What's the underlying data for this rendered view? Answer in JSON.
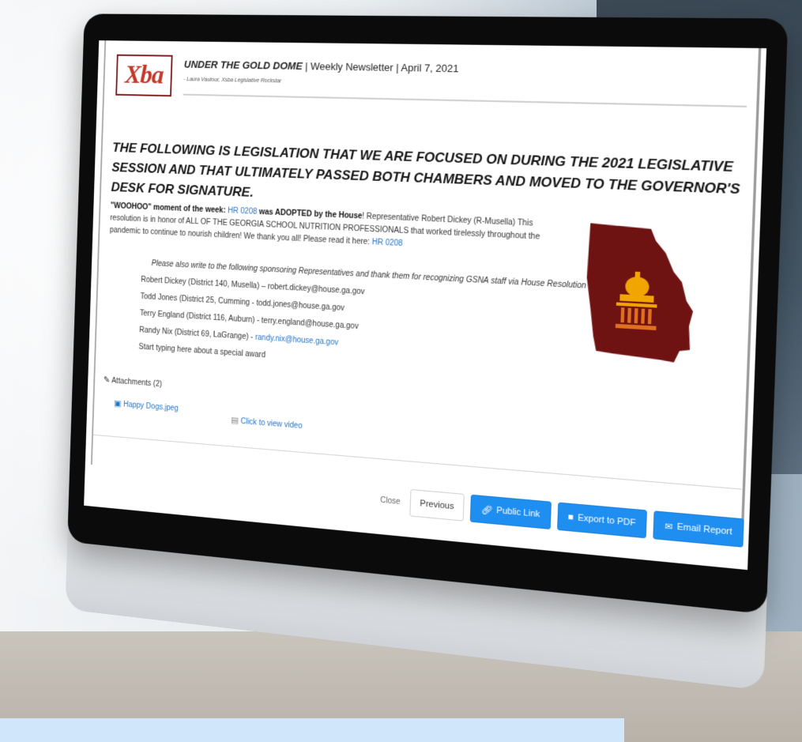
{
  "newsletter": {
    "logo_text": "Xba",
    "title_bold": "UNDER THE GOLD DOME",
    "title_rest": " | Weekly Newsletter | April 7, 2021",
    "byline": "- Laura Vautour, Xsba Legislative Rockstar"
  },
  "heading": "THE FOLLOWING IS LEGISLATION THAT WE ARE FOCUSED ON DURING THE 2021 LEGISLATIVE SESSION AND THAT ULTIMATELY PASSED BOTH CHAMBERS AND MOVED TO THE GOVERNOR'S DESK FOR SIGNATURE.",
  "woohoo": {
    "lead": "\"WOOHOO\" moment of the week: ",
    "link1": "HR 0208",
    "adopted": " was ADOPTED by the House",
    "bang": "! ",
    "body": "Representative Robert Dickey (R-Musella) This resolution is in honor of ALL OF THE GEORGIA SCHOOL NUTRITION PROFESSIONALS that worked tirelessly throughout the pandemic to continue to nourish children! We thank you all! Please read it here: ",
    "link2": "HR 0208"
  },
  "sponsors": {
    "intro": "Please also write to the following sponsoring Representatives and thank them for recognizing GSNA staff via House Resolution 208:",
    "lines": [
      "Robert Dickey (District 140, Musella) – robert.dickey@house.ga.gov",
      "Todd Jones (District 25, Cumming - todd.jones@house.ga.gov",
      "Terry England (District 116, Auburn) - terry.england@house.ga.gov"
    ],
    "nix_prefix": "Randy Nix (District 69, LaGrange) - ",
    "nix_email": "randy.nix@house.ga.gov",
    "special": "Start typing here about a special award"
  },
  "attachments": {
    "label": "Attachments (2)",
    "items": [
      "Happy Dogs.jpeg",
      "Click to view video"
    ]
  },
  "footer": {
    "close": "Close",
    "previous": "Previous",
    "public_link": "Public Link",
    "export_pdf": "Export to PDF",
    "email_report": "Email Report"
  },
  "colors": {
    "accent_blue": "#1f8ef1",
    "link_blue": "#1f73c8",
    "map_maroon": "#6e1212",
    "capitol_gold": "#f0a500"
  },
  "icons": {
    "paperclip": "paperclip-icon",
    "image": "image-file-icon",
    "video": "video-file-icon",
    "link": "link-icon",
    "pdf": "pdf-icon",
    "email": "envelope-icon"
  }
}
